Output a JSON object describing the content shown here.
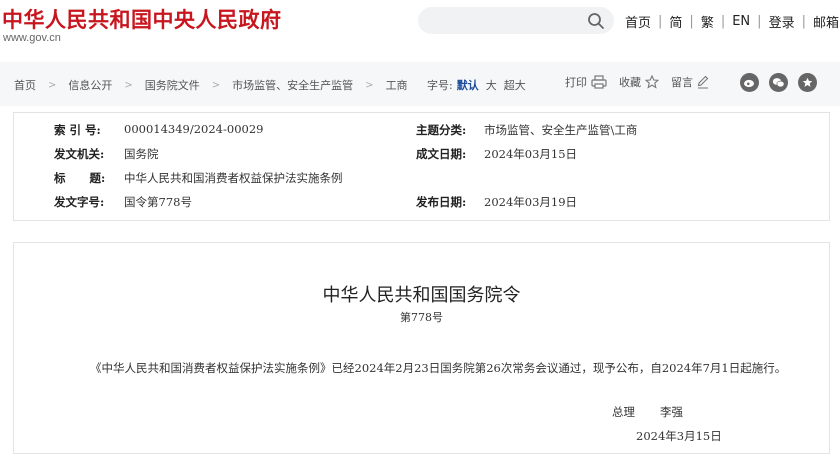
{
  "header": {
    "site_title": "中华人民共和国中央人民政府",
    "site_url": "www.gov.cn",
    "search_placeholder": "",
    "links": [
      "首页",
      "简",
      "繁",
      "EN",
      "登录",
      "邮箱"
    ]
  },
  "breadcrumb": [
    "首页",
    "信息公开",
    "国务院文件",
    "市场监管、安全生产监管",
    "工商"
  ],
  "font_size": {
    "label": "字号:",
    "selected": "默认",
    "options": [
      "大",
      "超大"
    ]
  },
  "actions": {
    "print": "打印",
    "favorite": "收藏",
    "comment": "留言"
  },
  "share_icons": [
    "weibo-icon",
    "wechat-icon",
    "star-icon"
  ],
  "info": {
    "index_label": "索  引  号:",
    "index_value": "000014349/2024-00029",
    "topic_label": "主题分类:",
    "topic_value": "市场监管、安全生产监管\\工商",
    "issuer_label": "发文机关:",
    "issuer_value": "国务院",
    "written_label": "成文日期:",
    "written_value": "2024年03月15日",
    "title_label": "标      题:",
    "title_value": "中华人民共和国消费者权益保护法实施条例",
    "docno_label": "发文字号:",
    "docno_value": "国令第778号",
    "published_label": "发布日期:",
    "published_value": "2024年03月19日"
  },
  "document": {
    "title": "中华人民共和国国务院令",
    "number": "第778号",
    "body": "《中华人民共和国消费者权益保护法实施条例》已经2024年2月23日国务院第26次常务会议通过，现予公布，自2024年7月1日起施行。",
    "signer_title": "总理",
    "signer_name": "李强",
    "sign_date": "2024年3月15日"
  },
  "colors": {
    "brand_red": "#c8161e",
    "accent_blue": "#1f4e9a"
  }
}
